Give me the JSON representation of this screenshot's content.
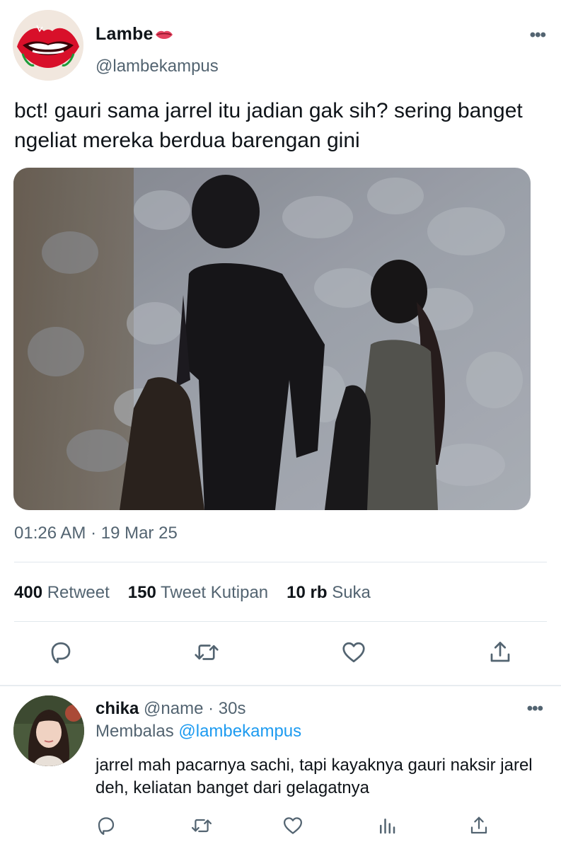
{
  "tweet": {
    "author_name": "Lambe",
    "author_handle": "@lambekampus",
    "more_icon": "more-horizontal-icon",
    "text": "bct! gauri sama jarrel itu jadian gak sih? sering banget ngeliat mereka berdua barengan gini",
    "timestamp": "01:26 AM · 19 Mar 25",
    "stats": {
      "retweets_value": "400",
      "retweets_label": "Retweet",
      "quotes_value": "150",
      "quotes_label": "Tweet Kutipan",
      "likes_value": "10 rb",
      "likes_label": "Suka"
    },
    "actions": [
      "reply-icon",
      "retweet-icon",
      "like-icon",
      "share-icon"
    ]
  },
  "reply": {
    "name": "chika",
    "handle": "@name",
    "time": "· 30s",
    "replying_prefix": "Membalas",
    "replying_to": "@lambekampus",
    "text": "jarrel mah pacarnya sachi, tapi kayaknya gauri naksir jarel deh, keliatan banget dari gelagatnya",
    "actions": [
      "reply-icon",
      "retweet-icon",
      "like-icon",
      "analytics-icon",
      "share-icon"
    ]
  },
  "colors": {
    "text_primary": "#0f1419",
    "text_secondary": "#536471",
    "link": "#1d9bf0",
    "divider": "#e1e8ed",
    "avatar_lips": "#d8102a"
  }
}
